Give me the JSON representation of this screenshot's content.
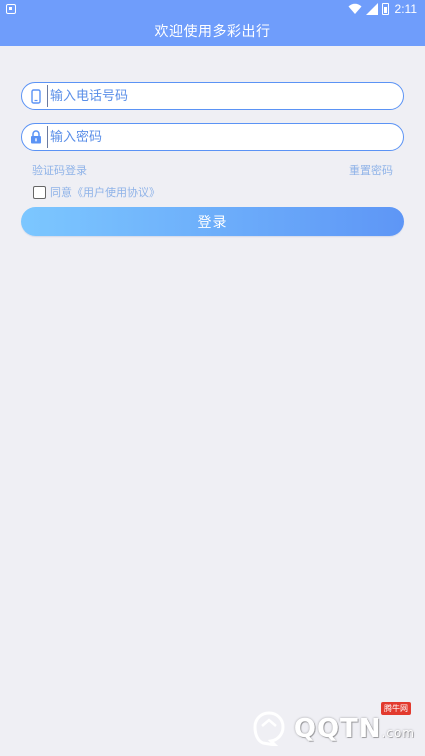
{
  "status_bar": {
    "time": "2:11",
    "icons": [
      "notification-icon",
      "wifi-icon",
      "signal-icon",
      "battery-icon"
    ]
  },
  "app": {
    "title": "欢迎使用多彩出行"
  },
  "form": {
    "phone": {
      "icon": "phone-icon",
      "placeholder": "输入电话号码",
      "value": ""
    },
    "password": {
      "icon": "lock-icon",
      "placeholder": "输入密码",
      "value": ""
    },
    "sms_login_link": "验证码登录",
    "reset_password_link": "重置密码",
    "agreement": {
      "checked": false,
      "label": "同意《用户使用协议》"
    },
    "login_button": "登录"
  },
  "watermark": {
    "text": "QQTN",
    "suffix": ".com",
    "badge": "腾牛网"
  },
  "colors": {
    "primary": "#6f9dfb",
    "field_border": "#5b93f5",
    "link": "#8fb3e8",
    "button_start": "#7cc7ff",
    "button_end": "#5e96f6",
    "background": "#efeff4"
  }
}
